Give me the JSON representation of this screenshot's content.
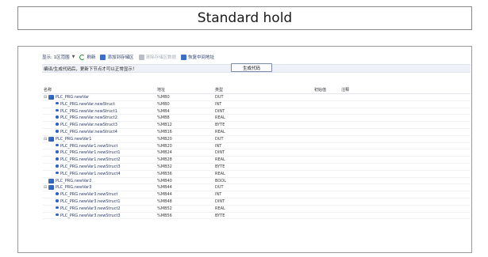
{
  "title": "Standard hold",
  "toolbar": {
    "display_label": "显示: 1区范围",
    "refresh_label": "刷新",
    "add_label": "添加到存储区",
    "clear_label": "清除存储区数据",
    "restore_label": "恢复中间地址"
  },
  "hint": "编译/生成代码后，更新下节点才可以正常显示！",
  "generate_button": "生成代码",
  "columns": {
    "name": "名称",
    "address": "地址",
    "type": "类型",
    "initial": "初始值",
    "comment": "注释"
  },
  "rows": [
    {
      "name": "PLC_PRG.newVar",
      "address": "%MB0",
      "type": "DUT",
      "level": 0,
      "expanded": true
    },
    {
      "name": "PLC_PRG.newVar.newStruct",
      "address": "%MB0",
      "type": "INT",
      "level": 1
    },
    {
      "name": "PLC_PRG.newVar.newStruct1",
      "address": "%MB4",
      "type": "DINT",
      "level": 1
    },
    {
      "name": "PLC_PRG.newVar.newStruct2",
      "address": "%MB8",
      "type": "REAL",
      "level": 1
    },
    {
      "name": "PLC_PRG.newVar.newStruct3",
      "address": "%MB12",
      "type": "BYTE",
      "level": 1
    },
    {
      "name": "PLC_PRG.newVar.newStruct4",
      "address": "%MB16",
      "type": "REAL",
      "level": 1
    },
    {
      "name": "PLC_PRG.newVar1",
      "address": "%MB20",
      "type": "DUT",
      "level": 0,
      "expanded": true
    },
    {
      "name": "PLC_PRG.newVar1.newStruct",
      "address": "%MB20",
      "type": "INT",
      "level": 1
    },
    {
      "name": "PLC_PRG.newVar1.newStruct1",
      "address": "%MB24",
      "type": "DINT",
      "level": 1
    },
    {
      "name": "PLC_PRG.newVar1.newStruct2",
      "address": "%MB28",
      "type": "REAL",
      "level": 1
    },
    {
      "name": "PLC_PRG.newVar1.newStruct3",
      "address": "%MB32",
      "type": "BYTE",
      "level": 1
    },
    {
      "name": "PLC_PRG.newVar1.newStruct4",
      "address": "%MB36",
      "type": "REAL",
      "level": 1
    },
    {
      "name": "PLC_PRG.newVar2",
      "address": "%MB40",
      "type": "BOOL",
      "level": 0,
      "expanded": false
    },
    {
      "name": "PLC_PRG.newVar3",
      "address": "%MB44",
      "type": "DUT",
      "level": 0,
      "expanded": true
    },
    {
      "name": "PLC_PRG.newVar3.newStruct",
      "address": "%MB44",
      "type": "INT",
      "level": 1
    },
    {
      "name": "PLC_PRG.newVar3.newStruct1",
      "address": "%MB48",
      "type": "DINT",
      "level": 1
    },
    {
      "name": "PLC_PRG.newVar3.newStruct2",
      "address": "%MB52",
      "type": "REAL",
      "level": 1
    },
    {
      "name": "PLC_PRG.newVar3.newStruct3",
      "address": "%MB56",
      "type": "BYTE",
      "level": 1
    }
  ]
}
